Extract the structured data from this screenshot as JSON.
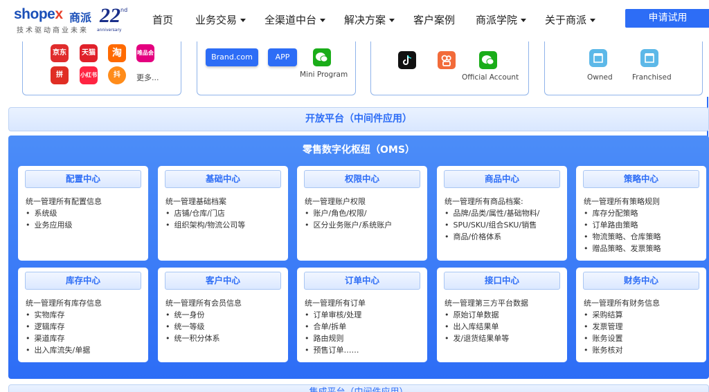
{
  "logo": {
    "brand": "shopex",
    "brand_cn": "商派",
    "slogan": "技术驱动商业未来",
    "num": "22",
    "suffix": "nd",
    "anniversary": "anniversary"
  },
  "nav": {
    "items": [
      {
        "label": "首页",
        "dropdown": false
      },
      {
        "label": "业务交易",
        "dropdown": true
      },
      {
        "label": "全渠道中台",
        "dropdown": true
      },
      {
        "label": "解决方案",
        "dropdown": true
      },
      {
        "label": "客户案例",
        "dropdown": false
      },
      {
        "label": "商派学院",
        "dropdown": true
      },
      {
        "label": "关于商派",
        "dropdown": true
      }
    ],
    "apply": "申请试用"
  },
  "top": {
    "ecom": {
      "apps": [
        {
          "label": "京东",
          "color": "#e02c2c"
        },
        {
          "label": "天猫",
          "color": "#e0202a"
        },
        {
          "label": "淘",
          "color": "#ff6a00"
        },
        {
          "label": "唯品会",
          "color": "#e4007f"
        },
        {
          "label": "拼",
          "color": "#e02e24"
        },
        {
          "label": "小红书",
          "color": "#ff2442"
        },
        {
          "label": "抖",
          "color": "#ff8c1a"
        }
      ],
      "more": "更多..."
    },
    "own": {
      "brand": "Brand.com",
      "app": "APP",
      "mini": "Mini Program"
    },
    "social": {
      "official": "Official Account"
    },
    "store": {
      "owned": "Owned",
      "franchised": "Franchised"
    }
  },
  "open_platform": "开放平台（中间件应用）",
  "oms": {
    "title": "零售数字化枢纽（OMS）",
    "modules": [
      {
        "title": "配置中心",
        "desc": "统一管理所有配置信息",
        "items": [
          "系统级",
          "业务应用级"
        ]
      },
      {
        "title": "基础中心",
        "desc": "统一管理基础档案",
        "items": [
          "店铺/仓库/门店",
          "组织架构/物流公司等"
        ]
      },
      {
        "title": "权限中心",
        "desc": "统一管理账户权限",
        "items": [
          "账户/角色/权限/",
          "区分业务账户/系统账户"
        ]
      },
      {
        "title": "商品中心",
        "desc": "统一管理所有商品档案:",
        "items": [
          "品牌/品类/属性/基础物料/",
          "SPU/SKU/组合SKU/销售",
          "商品/价格体系"
        ]
      },
      {
        "title": "策略中心",
        "desc": "统一管理所有策略规则",
        "items": [
          "库存分配策略",
          "订单路由策略",
          "物流策略、仓库策略",
          "赠品策略、发票策略"
        ]
      },
      {
        "title": "库存中心",
        "desc": "统一管理所有库存信息",
        "items": [
          "实物库存",
          "逻辑库存",
          "渠道库存",
          "出入库流失/单据"
        ]
      },
      {
        "title": "客户中心",
        "desc": "统一管理所有会员信息",
        "items": [
          "统一身份",
          "统一等级",
          "统一积分体系"
        ]
      },
      {
        "title": "订单中心",
        "desc": "统一管理所有订单",
        "items": [
          "订单审核/处理",
          "合单/拆单",
          "路由规则",
          "预售订单……"
        ]
      },
      {
        "title": "接口中心",
        "desc": "统一管理第三方平台数据",
        "items": [
          "原始订单数据",
          "出入库结果单",
          "发/退货结果单等"
        ]
      },
      {
        "title": "财务中心",
        "desc": "统一管理所有财务信息",
        "items": [
          "采购结算",
          "发票管理",
          "账务设置",
          "账务核对"
        ]
      }
    ]
  },
  "bottom_bar": "集成平台（中间件应用）"
}
